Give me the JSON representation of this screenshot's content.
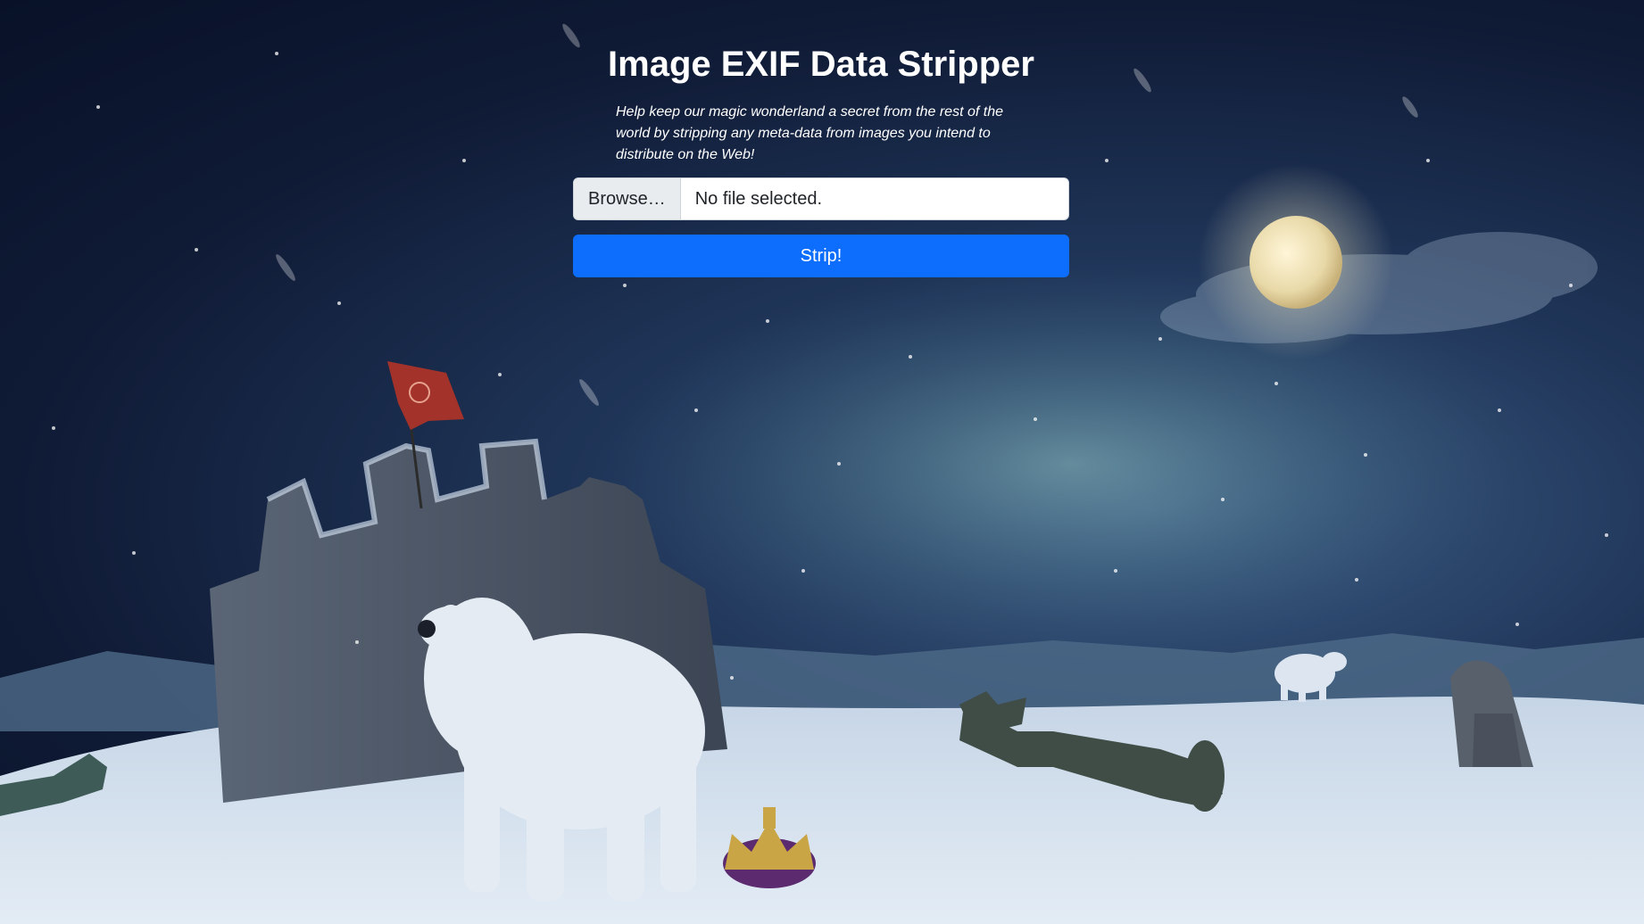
{
  "header": {
    "title": "Image EXIF Data Stripper",
    "subtitle": "Help keep our magic wonderland a secret from the rest of the world by stripping any meta-data from images you intend to distribute on the Web!"
  },
  "upload": {
    "browse_label": "Browse…",
    "status_text": "No file selected.",
    "submit_label": "Strip!"
  },
  "colors": {
    "accent": "#0d6efd",
    "title_text": "#ffffff",
    "night_sky": "#0f1a35",
    "snow": "#c9d6e6"
  }
}
